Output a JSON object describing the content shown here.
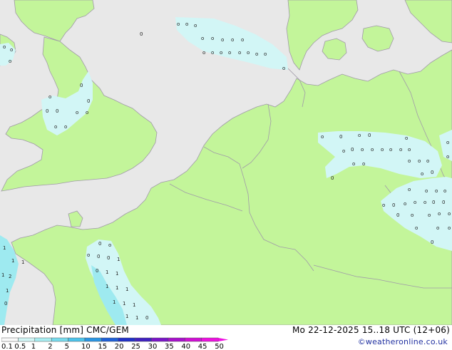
{
  "title": "Precipitation [mm]  CMC/GEM",
  "datetime": "Mo 22-12-2025 15..18 UTC (12+06)",
  "credit": "©weatheronline.co.uk",
  "colors": {
    "sea": "#e8e8e8",
    "land": "#c3f59a",
    "border": "#a09aa8",
    "rain_light": "#d2f6f6",
    "rain_mid": "#9eeaf0"
  },
  "legend": {
    "labels": [
      "0.1",
      "0.5",
      "1",
      "2",
      "5",
      "10",
      "15",
      "20",
      "25",
      "30",
      "35",
      "40",
      "45",
      "50"
    ],
    "colors": [
      "#fafafa",
      "#d2f6f6",
      "#a8eef2",
      "#78dcee",
      "#4cc4ec",
      "#2a96e4",
      "#1e60d8",
      "#2030c8",
      "#4020c0",
      "#7a14c8",
      "#a810cc",
      "#d00ed4",
      "#ee10e0"
    ]
  }
}
